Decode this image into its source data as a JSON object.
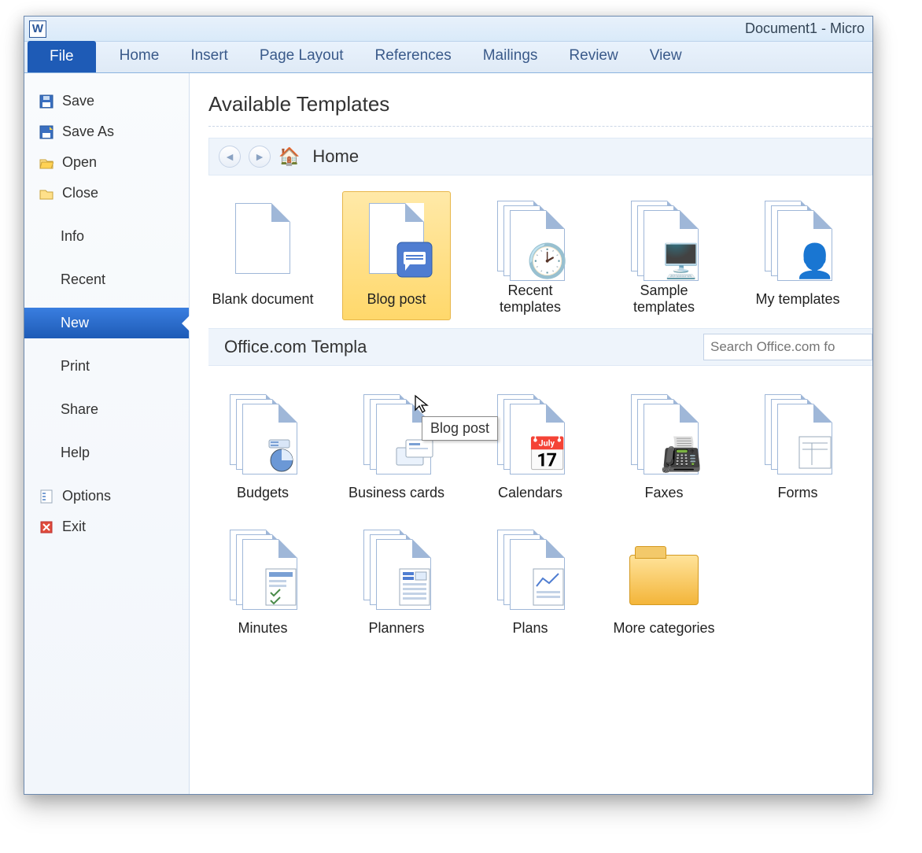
{
  "window": {
    "title": "Document1 - Micro",
    "app_letter": "W"
  },
  "ribbon": {
    "tabs": [
      "File",
      "Home",
      "Insert",
      "Page Layout",
      "References",
      "Mailings",
      "Review",
      "View"
    ],
    "active": "File"
  },
  "backstage": {
    "items": [
      {
        "label": "Save",
        "icon": "save"
      },
      {
        "label": "Save As",
        "icon": "saveas"
      },
      {
        "label": "Open",
        "icon": "open"
      },
      {
        "label": "Close",
        "icon": "close"
      }
    ],
    "links": [
      "Info",
      "Recent",
      "New",
      "Print",
      "Share",
      "Help"
    ],
    "selected": "New",
    "footer": [
      {
        "label": "Options",
        "icon": "options"
      },
      {
        "label": "Exit",
        "icon": "exit"
      }
    ]
  },
  "content": {
    "heading": "Available Templates",
    "breadcrumb": "Home",
    "templates": [
      {
        "label": "Blank document",
        "icon": "blank"
      },
      {
        "label": "Blog post",
        "icon": "blog",
        "selected": true,
        "tooltip": "Blog post"
      },
      {
        "label": "Recent templates",
        "icon": "recent"
      },
      {
        "label": "Sample templates",
        "icon": "sample"
      },
      {
        "label": "My templates",
        "icon": "my"
      }
    ],
    "office_section": "Office.com Templa",
    "search_placeholder": "Search Office.com fo",
    "office_templates": [
      {
        "label": "Budgets",
        "icon": "budgets"
      },
      {
        "label": "Business cards",
        "icon": "bizcards"
      },
      {
        "label": "Calendars",
        "icon": "calendars"
      },
      {
        "label": "Faxes",
        "icon": "faxes"
      },
      {
        "label": "Forms",
        "icon": "forms"
      },
      {
        "label": "Minutes",
        "icon": "minutes"
      },
      {
        "label": "Planners",
        "icon": "planners"
      },
      {
        "label": "Plans",
        "icon": "plans"
      },
      {
        "label": "More categories",
        "icon": "folder"
      }
    ]
  }
}
